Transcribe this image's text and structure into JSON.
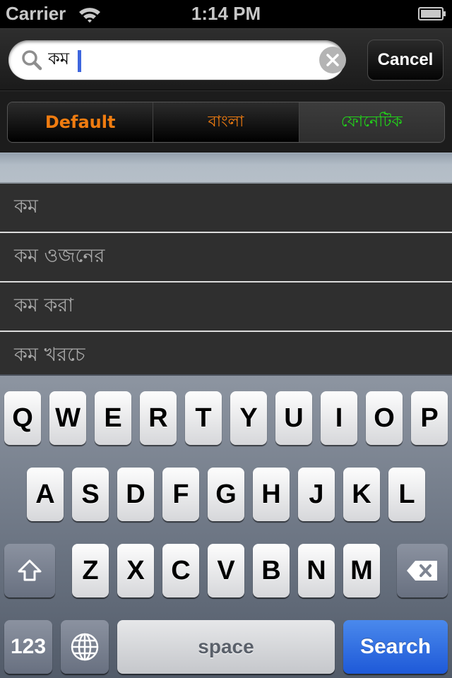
{
  "status_bar": {
    "carrier": "Carrier",
    "time": "1:14 PM",
    "wifi_icon": "wifi-icon",
    "battery_icon": "battery-icon"
  },
  "search": {
    "value": "কম",
    "placeholder": "",
    "search_icon": "search-icon",
    "clear_icon": "clear-icon",
    "cancel_label": "Cancel"
  },
  "segments": {
    "selected": "ফোনেটিক",
    "items": [
      {
        "label": "Default",
        "color": "#f07c10"
      },
      {
        "label": "বাংলা",
        "color": "#f07c10"
      },
      {
        "label": "ফোনেটিক",
        "color": "#22d21a"
      }
    ]
  },
  "results": [
    {
      "label": "কম"
    },
    {
      "label": "কম ওজনের"
    },
    {
      "label": "কম করা"
    },
    {
      "label": "কম খরচে"
    }
  ],
  "keyboard": {
    "row1": [
      "Q",
      "W",
      "E",
      "R",
      "T",
      "Y",
      "U",
      "I",
      "O",
      "P"
    ],
    "row2": [
      "A",
      "S",
      "D",
      "F",
      "G",
      "H",
      "J",
      "K",
      "L"
    ],
    "row3": [
      "Z",
      "X",
      "C",
      "V",
      "B",
      "N",
      "M"
    ],
    "shift_icon": "shift-icon",
    "delete_icon": "delete-icon",
    "numbers_label": "123",
    "globe_icon": "globe-icon",
    "space_label": "space",
    "search_label": "Search",
    "search_color": "#2a66e0"
  }
}
